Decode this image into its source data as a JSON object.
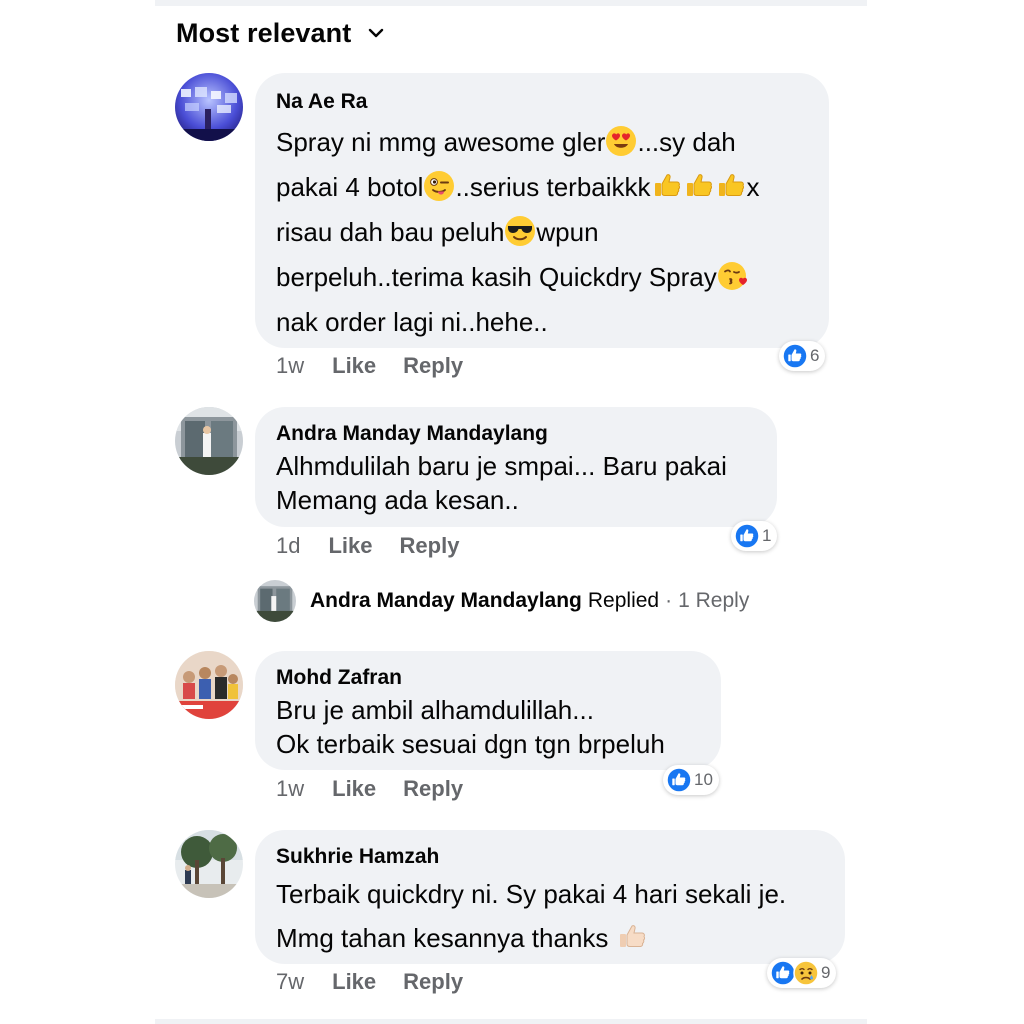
{
  "sort": {
    "label": "Most relevant"
  },
  "comments": [
    {
      "author": "Na Ae Ra",
      "lines": {
        "l1a": "Spray ni mmg awesome gler",
        "l1b": "...sy dah",
        "l2a": "pakai 4 botol",
        "l2b": "..serius terbaikkk",
        "l2c": "x",
        "l3a": "risau dah bau peluh",
        "l3b": "wpun",
        "l4a": "berpeluh..terima kasih Quickdry Spray",
        "l5a": "nak order lagi ni..hehe.."
      },
      "emojis": [
        "heart-eyes-emoji",
        "tongue-wink-emoji",
        "thumbs-up-emoji",
        "thumbs-up-emoji",
        "thumbs-up-emoji",
        "sunglasses-emoji",
        "kissing-heart-emoji"
      ],
      "time": "1w",
      "like_label": "Like",
      "reply_label": "Reply",
      "reactions": {
        "count": "6",
        "types": [
          "like"
        ]
      }
    },
    {
      "author": "Andra Manday Mandaylang",
      "lines": {
        "l1": "Alhmdulilah baru je smpai... Baru pakai",
        "l2": "Memang ada kesan.."
      },
      "time": "1d",
      "like_label": "Like",
      "reply_label": "Reply",
      "reactions": {
        "count": "1",
        "types": [
          "like"
        ]
      },
      "replies": {
        "author": "Andra Manday Mandaylang",
        "label": "Replied",
        "separator": "·",
        "count_label": "1 Reply"
      }
    },
    {
      "author": "Mohd Zafran",
      "lines": {
        "l1": "Bru je ambil alhamdulillah...",
        "l2": "Ok terbaik sesuai dgn tgn brpeluh"
      },
      "time": "1w",
      "like_label": "Like",
      "reply_label": "Reply",
      "reactions": {
        "count": "10",
        "types": [
          "like"
        ]
      }
    },
    {
      "author": "Sukhrie Hamzah",
      "lines": {
        "l1": "Terbaik quickdry ni. Sy pakai 4 hari sekali je.",
        "l2": "Mmg tahan kesannya thanks"
      },
      "emojis": [
        "thumbs-up-light-emoji"
      ],
      "time": "7w",
      "like_label": "Like",
      "reply_label": "Reply",
      "reactions": {
        "count": "9",
        "types": [
          "like",
          "sad"
        ]
      }
    }
  ],
  "colors": {
    "bubble": "#f0f2f5",
    "meta": "#65676b",
    "like_blue": "#1877f2",
    "text": "#050505"
  }
}
